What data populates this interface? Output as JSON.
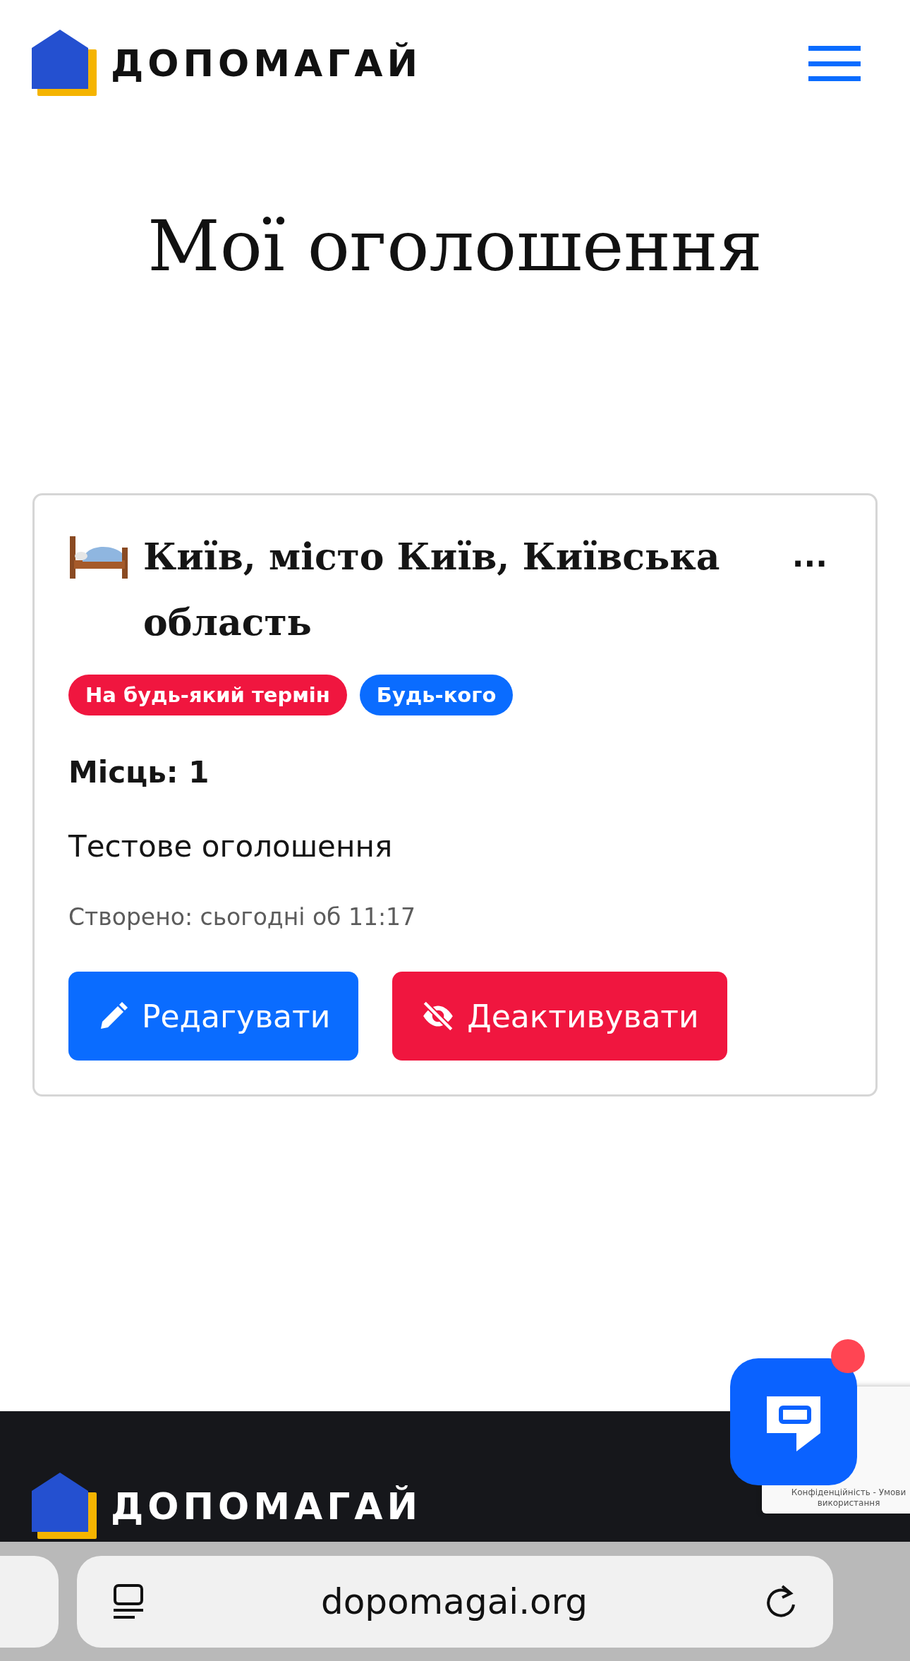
{
  "header": {
    "brand": "ДОПОМАГАЙ"
  },
  "page_title": "Мої оголошення",
  "listings": [
    {
      "title": "Київ, місто Київ, Київська область",
      "menu": "...",
      "tags": [
        {
          "label": "На будь-який термін",
          "color": "#f0163f"
        },
        {
          "label": "Будь-кого",
          "color": "#0a6cff"
        }
      ],
      "places": "Місць: 1",
      "description": "Тестове оголошення",
      "created": "Створено: сьогодні об 11:17",
      "actions": [
        {
          "kind": "edit",
          "label": "Редагувати"
        },
        {
          "kind": "deactivate",
          "label": "Деактивувати"
        }
      ]
    }
  ],
  "footer": {
    "brand": "ДОПОМАГАЙ"
  },
  "chat": {
    "unread": true
  },
  "recaptcha": {
    "text": "Конфіденційність - Умови використання"
  },
  "browser": {
    "url": "dopomagai.org"
  }
}
